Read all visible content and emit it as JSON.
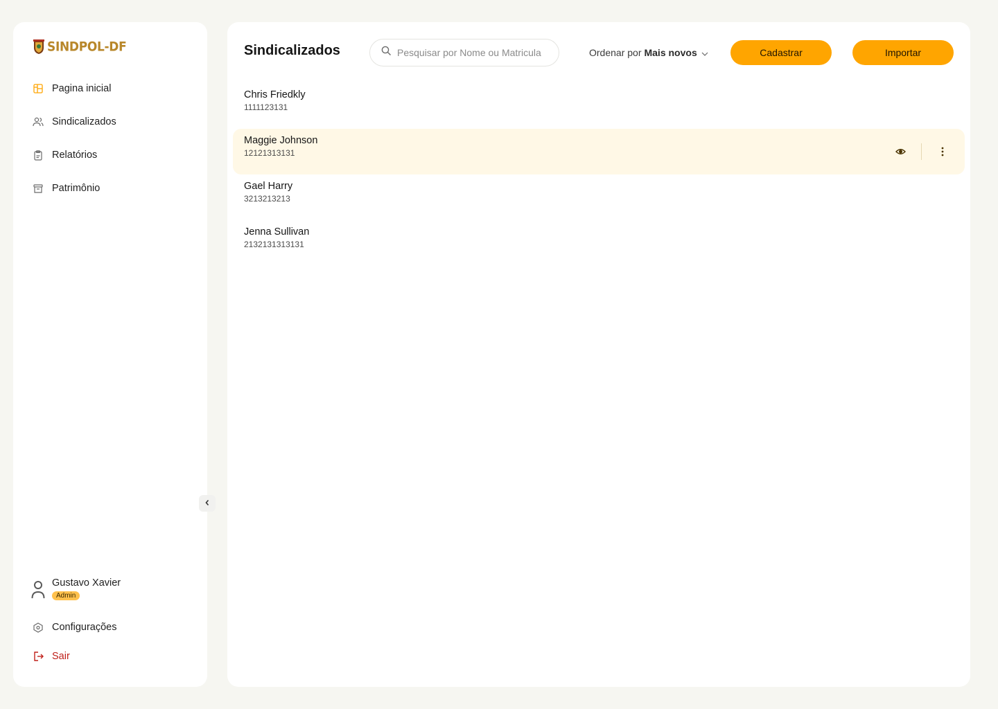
{
  "brand": {
    "logo_text": "SINDPOL-DF",
    "accent": "#ffa500"
  },
  "sidebar": {
    "items": [
      {
        "label": "Pagina inicial",
        "icon": "layout-icon",
        "active": true
      },
      {
        "label": "Sindicalizados",
        "icon": "users-icon"
      },
      {
        "label": "Relatórios",
        "icon": "clipboard-icon"
      },
      {
        "label": "Patrimônio",
        "icon": "archive-icon"
      }
    ],
    "user": {
      "name": "Gustavo Xavier",
      "role": "Admin"
    },
    "settings_label": "Configurações",
    "logout_label": "Sair"
  },
  "main": {
    "title": "Sindicalizados",
    "search": {
      "placeholder": "Pesquisar por Nome ou Matricula",
      "value": ""
    },
    "sort": {
      "prefix": "Ordenar por",
      "value": "Mais novos"
    },
    "buttons": {
      "register": "Cadastrar",
      "import": "Importar"
    },
    "rows": [
      {
        "name": "Chris Friedkly",
        "matricula": "1111123131"
      },
      {
        "name": "Maggie Johnson",
        "matricula": "12121313131",
        "highlighted": true
      },
      {
        "name": "Gael Harry",
        "matricula": "3213213213"
      },
      {
        "name": "Jenna Sullivan",
        "matricula": "2132131313131"
      }
    ]
  }
}
